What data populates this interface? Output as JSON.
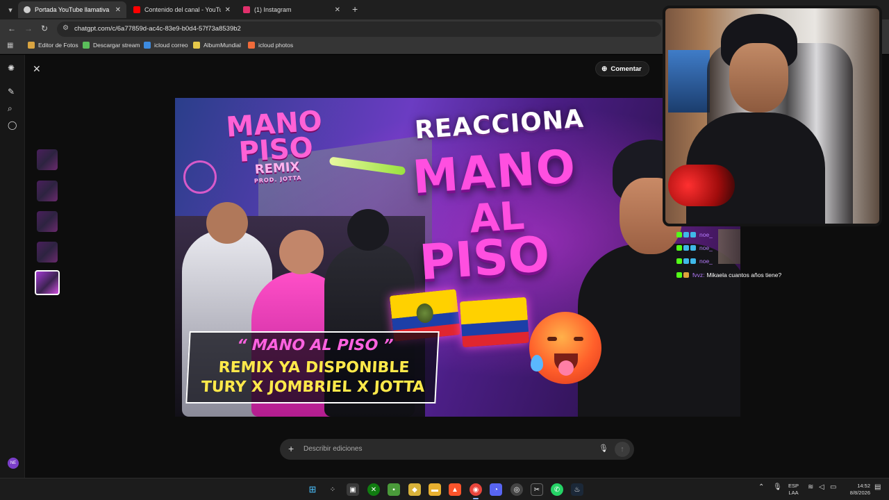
{
  "browser": {
    "tabs": [
      {
        "title": "Portada YouTube llamativa",
        "active": true,
        "favicon_color": "#cfcfcf"
      },
      {
        "title": "Contenido del canal - YouTube",
        "active": false,
        "favicon_color": "#ff0000"
      },
      {
        "title": "(1) Instagram",
        "active": false,
        "favicon_color": "#e1306c"
      }
    ],
    "url": "chatgpt.com/c/6a77859d-ac4c-83e9-b0d4-57f73a8539b2",
    "bookmarks": [
      {
        "label": "Editor de Fotos",
        "icon_color": "#d9a441"
      },
      {
        "label": "Descargar stream",
        "icon_color": "#5bbf5b"
      },
      {
        "label": "icloud correo",
        "icon_color": "#3d8be0"
      },
      {
        "label": "AlbumMundial",
        "icon_color": "#e6c84a"
      },
      {
        "label": "icloud photos",
        "icon_color": "#f06b3a"
      }
    ]
  },
  "editor": {
    "comment_button": "Comentar",
    "composer_placeholder": "Describir ediciones",
    "avatar_initials": "NE"
  },
  "thumbnail": {
    "left_title_1": "MANO",
    "left_title_2": "PISO",
    "left_title_3": "REMIX",
    "left_credit": "PROD. JOTTA",
    "reacciona": "REACCIONA",
    "big_1": "MANO",
    "big_2": "AL",
    "big_3": "PISO",
    "banner_1": "“ MANO AL PISO ”",
    "banner_2": "REMIX YA DISPONIBLE",
    "banner_3": "TURY X JOMBRIEL X JOTTA"
  },
  "chat": [
    {
      "user": "noe_",
      "text": ""
    },
    {
      "user": "noe_",
      "text": ""
    },
    {
      "user": "noe_",
      "text": ""
    },
    {
      "user": "fvvz:",
      "text": "Mikaela cuantos años tiene?"
    }
  ],
  "taskbar": {
    "lang_1": "ESP",
    "lang_2": "LAA",
    "time": "14:52",
    "date": "8/8/2026"
  }
}
